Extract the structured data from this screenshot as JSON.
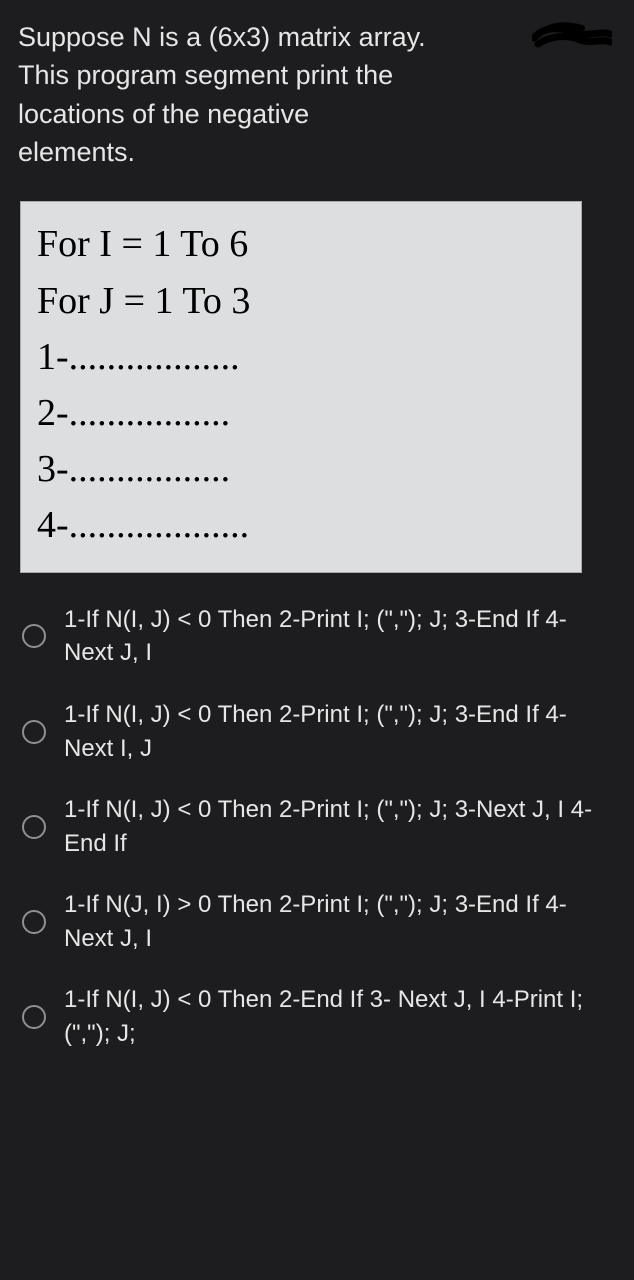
{
  "question": {
    "line1": "Suppose N is a (6x3) matrix array.",
    "line2": "This program segment print the",
    "line3": "locations of the negative",
    "line4": "elements."
  },
  "code": {
    "l1": "For I = 1 To 6",
    "l2": "For J = 1 To 3",
    "l3": "1-..................",
    "l4": "2-.................",
    "l5": "3-.................",
    "l6": "4-..................."
  },
  "options": {
    "a": "1-If N(I, J) < 0 Then 2-Print I; (\",\"); J; 3-End If 4-Next J, I",
    "b": "1-If N(I, J) < 0 Then 2-Print I; (\",\"); J; 3-End If 4-Next I, J",
    "c": "1-If N(I, J) < 0 Then 2-Print I; (\",\"); J; 3-Next J, I 4-End If",
    "d": "1-If N(J, I) > 0 Then 2-Print I; (\",\"); J; 3-End If 4-Next J, I",
    "e": "1-If N(I, J) < 0 Then 2-End If 3- Next J, I 4-Print I; (\",\"); J;"
  }
}
